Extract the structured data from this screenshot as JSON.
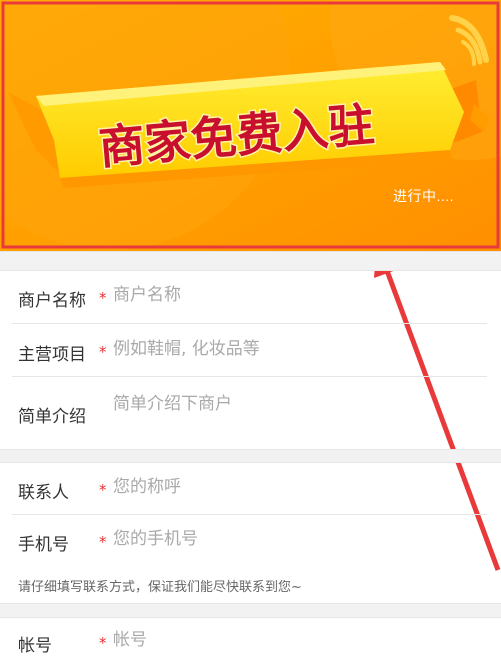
{
  "banner": {
    "title": "商家免费入驻",
    "status": "进行中...."
  },
  "form": {
    "merchant_name": {
      "label": "商户名称",
      "required_mark": "*",
      "placeholder": "商户名称"
    },
    "main_business": {
      "label": "主营项目",
      "required_mark": "*",
      "placeholder": "例如鞋帽, 化妆品等"
    },
    "description": {
      "label": "简单介绍",
      "placeholder": "简单介绍下商户"
    },
    "contact": {
      "label": "联系人",
      "required_mark": "*",
      "placeholder": "您的称呼"
    },
    "phone": {
      "label": "手机号",
      "required_mark": "*",
      "placeholder": "您的手机号"
    },
    "contact_hint": "请仔细填写联系方式，保证我们能尽快联系到您~",
    "account": {
      "label": "帐号",
      "required_mark": "*",
      "placeholder": "帐号"
    }
  },
  "colors": {
    "banner_orange": "#ffa000",
    "banner_ribbon": "#ffe000",
    "banner_title": "#c8102e",
    "annotation_red": "#e83a3a",
    "required": "#e83030"
  }
}
